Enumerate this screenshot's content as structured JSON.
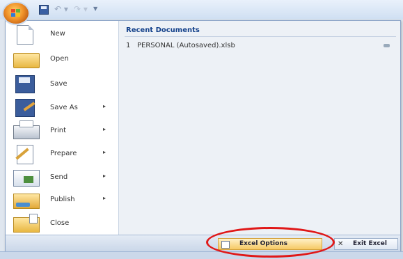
{
  "quick_access": {
    "office_button": "office-orb-icon",
    "icons": [
      "save-icon",
      "undo-icon",
      "redo-icon",
      "customize-icon"
    ]
  },
  "menu": {
    "items": [
      {
        "label": "New",
        "icon": "new-document-icon",
        "has_submenu": false
      },
      {
        "label": "Open",
        "icon": "open-folder-icon",
        "has_submenu": false
      },
      {
        "label": "Save",
        "icon": "save-disk-icon",
        "has_submenu": false
      },
      {
        "label": "Save As",
        "icon": "save-as-icon",
        "has_submenu": true
      },
      {
        "label": "Print",
        "icon": "printer-icon",
        "has_submenu": true
      },
      {
        "label": "Prepare",
        "icon": "prepare-icon",
        "has_submenu": true
      },
      {
        "label": "Send",
        "icon": "send-icon",
        "has_submenu": true
      },
      {
        "label": "Publish",
        "icon": "publish-icon",
        "has_submenu": true
      },
      {
        "label": "Close",
        "icon": "close-folder-icon",
        "has_submenu": false
      }
    ],
    "submenu_arrow": "▸"
  },
  "recent": {
    "title": "Recent Documents",
    "documents": [
      {
        "number": "1",
        "name": "PERSONAL (Autosaved).xlsb"
      }
    ]
  },
  "bottom": {
    "options_label": "Excel Options",
    "exit_label": "Exit Excel",
    "exit_glyph": "✕"
  },
  "colors": {
    "accent_title": "#15428b",
    "highlight": "#e01818",
    "options_button": "#f6c964"
  }
}
